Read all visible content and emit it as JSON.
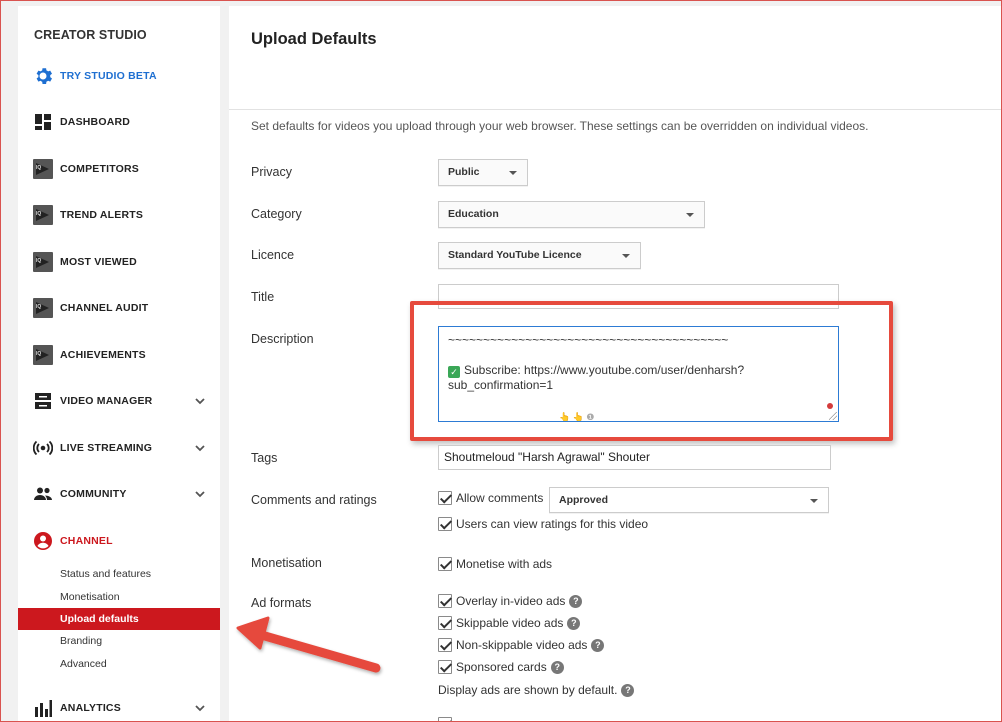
{
  "sidebar": {
    "title": "CREATOR STUDIO",
    "beta": "TRY STUDIO BETA",
    "items": [
      {
        "label": "DASHBOARD"
      },
      {
        "label": "COMPETITORS"
      },
      {
        "label": "TREND ALERTS"
      },
      {
        "label": "MOST VIEWED"
      },
      {
        "label": "CHANNEL AUDIT"
      },
      {
        "label": "ACHIEVEMENTS"
      },
      {
        "label": "VIDEO MANAGER"
      },
      {
        "label": "LIVE STREAMING"
      },
      {
        "label": "COMMUNITY"
      },
      {
        "label": "CHANNEL"
      },
      {
        "label": "ANALYTICS"
      }
    ],
    "channel_sub": [
      "Status and features",
      "Monetisation",
      "Upload defaults",
      "Branding",
      "Advanced"
    ],
    "iq_text": "IQ",
    "accent_blue": "#1e6fd1",
    "accent_red": "#cc181e"
  },
  "main": {
    "title": "Upload Defaults",
    "intro": "Set defaults for videos you upload through your web browser. These settings can be overridden on individual videos.",
    "labels": {
      "privacy": "Privacy",
      "category": "Category",
      "licence": "Licence",
      "title": "Title",
      "description": "Description",
      "tags": "Tags",
      "comments": "Comments and ratings",
      "monetisation": "Monetisation",
      "ad_formats": "Ad formats"
    },
    "privacy_value": "Public",
    "category_value": "Education",
    "licence_value": "Standard YouTube Licence",
    "title_value": "",
    "description": {
      "line1": "~~~~~~~~~~~~~~~~~~~~~~~~~~~~~~~~~~~~~~~~",
      "check": "✓",
      "line2": "Subscribe: https://www.youtube.com/user/denharsh?",
      "line3": "sub_confirmation=1",
      "emoji": "👆 👆 ❶"
    },
    "tags_value": "Shoutmeloud \"Harsh Agrawal\" Shouter",
    "allow_comments": "Allow comments",
    "comments_setting": "Approved",
    "view_ratings": "Users can view ratings for this video",
    "monetise": "Monetise with ads",
    "ad_formats": [
      "Overlay in-video ads",
      "Skippable video ads",
      "Non-skippable video ads",
      "Sponsored cards"
    ],
    "display_ads_note": "Display ads are shown by default.",
    "help": "?"
  }
}
